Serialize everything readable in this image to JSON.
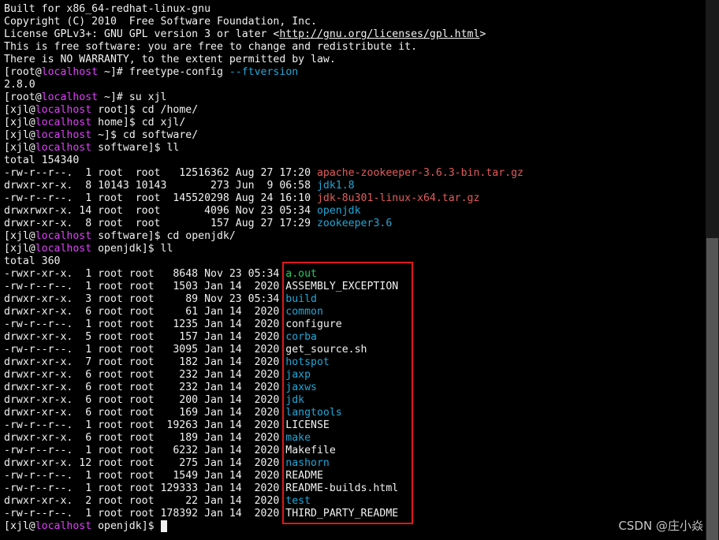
{
  "colors": {
    "background": "#000000",
    "foreground": "#f2f2f2",
    "hostname": "#e040fb",
    "archive": "#e35b5b",
    "directory": "#1fa7d7",
    "executable": "#20d060",
    "highlight_border": "#e01818"
  },
  "terminal": {
    "header": [
      "Built for x86_64-redhat-linux-gnu",
      "Copyright (C) 2010  Free Software Foundation, Inc.",
      "License GPLv3+: GNU GPL version 3 or later <",
      "http://gnu.org/licenses/gpl.html",
      ">",
      "This is free software: you are free to change and redistribute it.",
      "There is NO WARRANTY, to the extent permitted by law."
    ],
    "prompts": [
      {
        "user": "[root@",
        "host": "localhost",
        "path": " ~]# ",
        "cmd": "freetype-config ",
        "cmd2": "--ftversion"
      },
      {
        "user": "[root@",
        "host": "localhost",
        "path": " ~]# ",
        "cmd": "su xjl"
      },
      {
        "user": "[xjl@",
        "host": "localhost",
        "path": " root]$ ",
        "cmd": "cd /home/"
      },
      {
        "user": "[xjl@",
        "host": "localhost",
        "path": " home]$ ",
        "cmd": "cd xjl/"
      },
      {
        "user": "[xjl@",
        "host": "localhost",
        "path": " ~]$ ",
        "cmd": "cd software/"
      },
      {
        "user": "[xjl@",
        "host": "localhost",
        "path": " software]$ ",
        "cmd": "ll"
      },
      {
        "user": "[xjl@",
        "host": "localhost",
        "path": " software]$ ",
        "cmd": "cd openjdk/"
      },
      {
        "user": "[xjl@",
        "host": "localhost",
        "path": " openjdk]$ ",
        "cmd": "ll"
      },
      {
        "user": "[xjl@",
        "host": "localhost",
        "path": " openjdk]$ ",
        "cmd": ""
      }
    ],
    "version_output": "2.8.0",
    "software_total": "total 154340",
    "software_listing": [
      {
        "meta": "-rw-r--r--.  1 root  root   12516362 Aug 27 17:20 ",
        "name": "apache-zookeeper-3.6.3-bin.tar.gz",
        "kind": "ext"
      },
      {
        "meta": "drwxr-xr-x.  8 10143 10143       273 Jun  9 06:58 ",
        "name": "jdk1.8",
        "kind": "dir"
      },
      {
        "meta": "-rw-r--r--.  1 root  root  145520298 Aug 24 16:10 ",
        "name": "jdk-8u301-linux-x64.tar.gz",
        "kind": "ext"
      },
      {
        "meta": "drwxrwxr-x. 14 root  root       4096 Nov 23 05:34 ",
        "name": "openjdk",
        "kind": "dir"
      },
      {
        "meta": "drwxr-xr-x.  8 root  root        157 Aug 27 17:29 ",
        "name": "zookeeper3.6",
        "kind": "dir"
      }
    ],
    "openjdk_total": "total 360",
    "openjdk_listing": [
      {
        "meta": "-rwxr-xr-x.  1 root root   8648 Nov 23 05:34 ",
        "name": "a.out",
        "kind": "exe"
      },
      {
        "meta": "-rw-r--r--.  1 root root   1503 Jan 14  2020 ",
        "name": "ASSEMBLY_EXCEPTION",
        "kind": "file"
      },
      {
        "meta": "drwxr-xr-x.  3 root root     89 Nov 23 05:34 ",
        "name": "build",
        "kind": "dir"
      },
      {
        "meta": "drwxr-xr-x.  6 root root     61 Jan 14  2020 ",
        "name": "common",
        "kind": "dir"
      },
      {
        "meta": "-rw-r--r--.  1 root root   1235 Jan 14  2020 ",
        "name": "configure",
        "kind": "file"
      },
      {
        "meta": "drwxr-xr-x.  5 root root    157 Jan 14  2020 ",
        "name": "corba",
        "kind": "dir"
      },
      {
        "meta": "-rw-r--r--.  1 root root   3095 Jan 14  2020 ",
        "name": "get_source.sh",
        "kind": "file"
      },
      {
        "meta": "drwxr-xr-x.  7 root root    182 Jan 14  2020 ",
        "name": "hotspot",
        "kind": "dir"
      },
      {
        "meta": "drwxr-xr-x.  6 root root    232 Jan 14  2020 ",
        "name": "jaxp",
        "kind": "dir"
      },
      {
        "meta": "drwxr-xr-x.  6 root root    232 Jan 14  2020 ",
        "name": "jaxws",
        "kind": "dir"
      },
      {
        "meta": "drwxr-xr-x.  6 root root    200 Jan 14  2020 ",
        "name": "jdk",
        "kind": "dir"
      },
      {
        "meta": "drwxr-xr-x.  6 root root    169 Jan 14  2020 ",
        "name": "langtools",
        "kind": "dir"
      },
      {
        "meta": "-rw-r--r--.  1 root root  19263 Jan 14  2020 ",
        "name": "LICENSE",
        "kind": "file"
      },
      {
        "meta": "drwxr-xr-x.  6 root root    189 Jan 14  2020 ",
        "name": "make",
        "kind": "dir"
      },
      {
        "meta": "-rw-r--r--.  1 root root   6232 Jan 14  2020 ",
        "name": "Makefile",
        "kind": "file"
      },
      {
        "meta": "drwxr-xr-x. 12 root root    275 Jan 14  2020 ",
        "name": "nashorn",
        "kind": "dir"
      },
      {
        "meta": "-rw-r--r--.  1 root root   1549 Jan 14  2020 ",
        "name": "README",
        "kind": "file"
      },
      {
        "meta": "-rw-r--r--.  1 root root 129333 Jan 14  2020 ",
        "name": "README-builds.html",
        "kind": "file"
      },
      {
        "meta": "drwxr-xr-x.  2 root root     22 Jan 14  2020 ",
        "name": "test",
        "kind": "dir"
      },
      {
        "meta": "-rw-r--r--.  1 root root 178392 Jan 14  2020 ",
        "name": "THIRD_PARTY_README",
        "kind": "file"
      }
    ]
  },
  "watermark": "CSDN @庄小焱"
}
